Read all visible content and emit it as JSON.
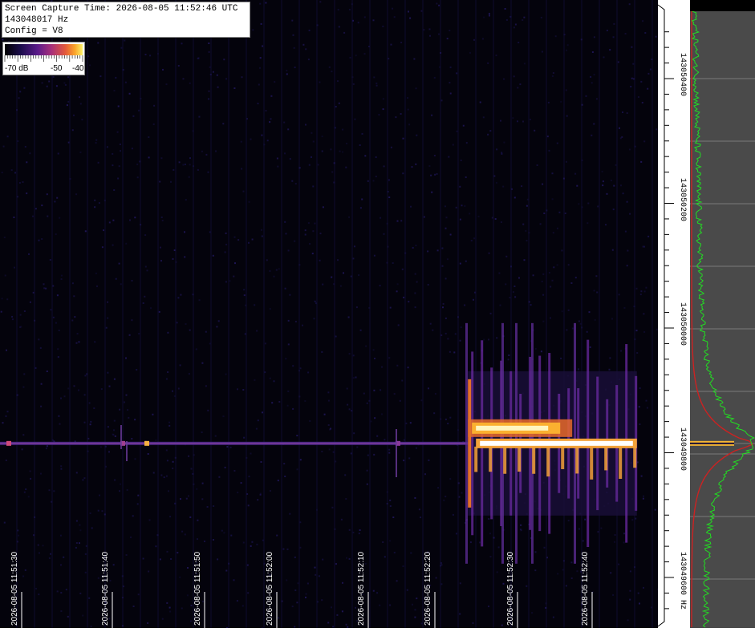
{
  "info": {
    "capture_time": "Screen Capture Time: 2026-08-05 11:52:46 UTC",
    "frequency": "143048017 Hz",
    "config": "Config = V8"
  },
  "colorbar": {
    "labels": [
      "-70 dB",
      "-50",
      "-40"
    ],
    "colors": [
      "#000000",
      "#1a0c4a",
      "#5a1b8a",
      "#a8307a",
      "#e45a3a",
      "#fba52a",
      "#fcf36a"
    ]
  },
  "colors": {
    "background": "#04030c",
    "spectrum_trace": "#22dd22",
    "average_trace": "#cc2222",
    "signal_peak": "#f7b733",
    "spectrum_bg": "#4a4a4a"
  },
  "chart_data": {
    "type": "heatmap",
    "title": "",
    "x_time_ticks": [
      "2026-08-05 11:51:30",
      "2026-08-05 11:51:40",
      "2026-08-05 11:51:50",
      "2026-08-05 11:52:00",
      "2026-08-05 11:52:10",
      "2026-08-05 11:52:20",
      "2026-08-05 11:52:30",
      "2026-08-05 11:52:40"
    ],
    "y_freq_ticks": [
      "143050400",
      "143050200",
      "143050000",
      "143049800",
      "143049600 Hz"
    ],
    "y_freq_values": [
      143050400,
      143050200,
      143050000,
      143049800,
      143049600
    ],
    "signal_frequency_hz": 143049815,
    "burst_start": "2026-08-05 11:52:24",
    "burst_end": "2026-08-05 11:52:46",
    "color_scale_db": [
      -70,
      -40
    ],
    "grid": true
  }
}
